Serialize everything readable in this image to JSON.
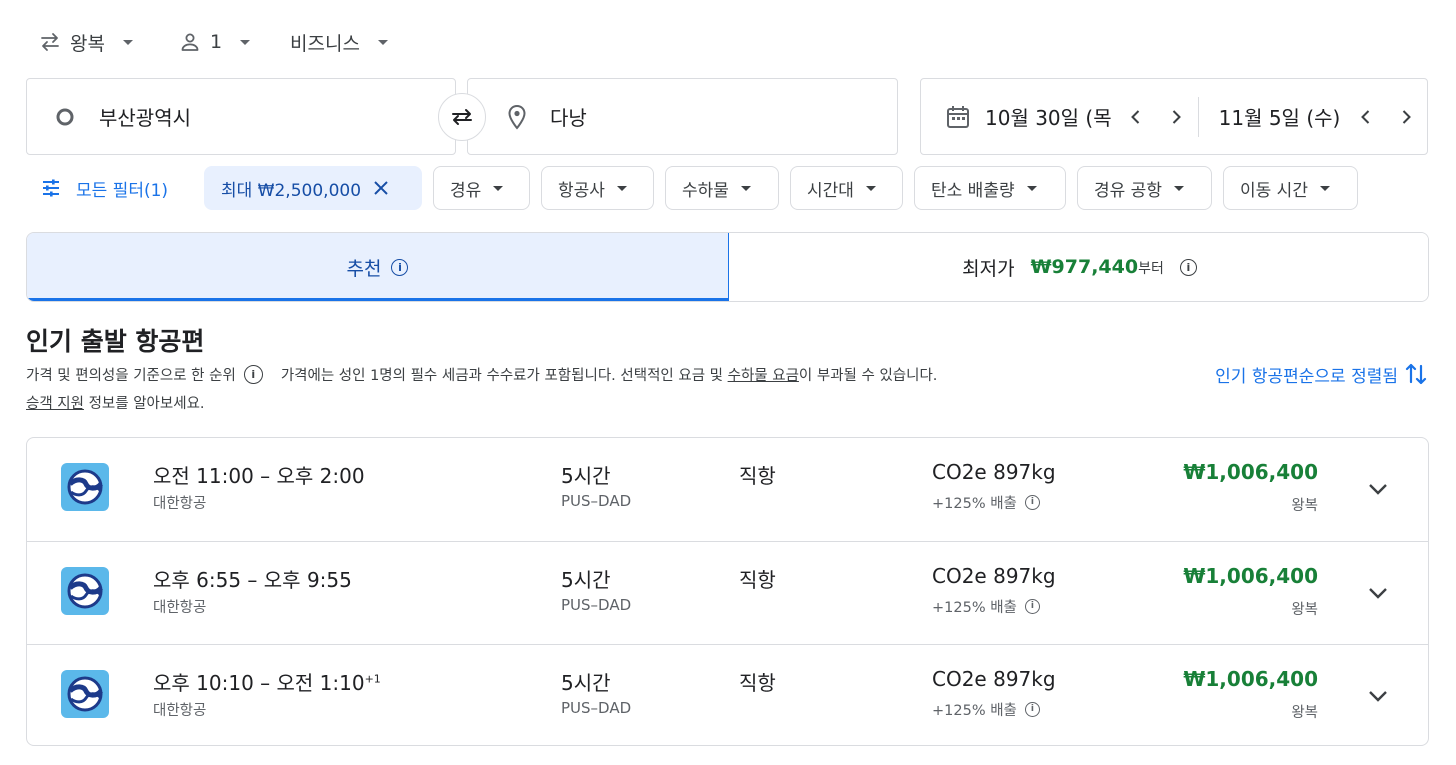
{
  "top_bar": {
    "trip_type": "왕복",
    "passengers": "1",
    "cabin_class": "비즈니스"
  },
  "search": {
    "origin": "부산광역시",
    "destination": "다낭",
    "depart_date": "10월 30일 (목",
    "return_date": "11월 5일 (수)"
  },
  "filters": {
    "all_filters_label": "모든 필터(1)",
    "price_chip": "최대 ₩2,500,000",
    "chips": [
      "경유",
      "항공사",
      "수하물",
      "시간대",
      "탄소 배출량",
      "경유 공항",
      "이동 시간"
    ]
  },
  "tabs": {
    "recommended": "추천",
    "cheapest_label": "최저가",
    "cheapest_price": "₩977,440",
    "cheapest_suffix": "부터"
  },
  "section": {
    "title": "인기 출발 항공편",
    "ranking_note": "가격 및 편의성을 기준으로 한 순위",
    "price_note_a": "가격에는 성인 1명의 필수 세금과 수수료가 포함됩니다. 선택적인 요금 및 ",
    "price_note_link": "수하물 요금",
    "price_note_b": "이 부과될 수 있습니다.",
    "help_link": "승객 지원",
    "help_suffix": " 정보를 알아보세요.",
    "sort_label": "인기 항공편순으로 정렬됨"
  },
  "flights": [
    {
      "times": "오전 11:00 – 오후 2:00",
      "day_offset": "",
      "airline": "대한항공",
      "duration": "5시간",
      "route": "PUS–DAD",
      "stops": "직항",
      "co2": "CO2e 897kg",
      "emissions": "+125% 배출",
      "price": "₩1,006,400",
      "trip": "왕복"
    },
    {
      "times": "오후 6:55 – 오후 9:55",
      "day_offset": "",
      "airline": "대한항공",
      "duration": "5시간",
      "route": "PUS–DAD",
      "stops": "직항",
      "co2": "CO2e 897kg",
      "emissions": "+125% 배출",
      "price": "₩1,006,400",
      "trip": "왕복"
    },
    {
      "times": "오후 10:10 – 오전 1:10",
      "day_offset": "+1",
      "airline": "대한항공",
      "duration": "5시간",
      "route": "PUS–DAD",
      "stops": "직항",
      "co2": "CO2e 897kg",
      "emissions": "+125% 배출",
      "price": "₩1,006,400",
      "trip": "왕복"
    }
  ],
  "colors": {
    "accent": "#1a73e8",
    "price_green": "#188038",
    "selected_tab_bg": "#e8f0fe",
    "airline_logo_bg": "#5bb8ea"
  }
}
